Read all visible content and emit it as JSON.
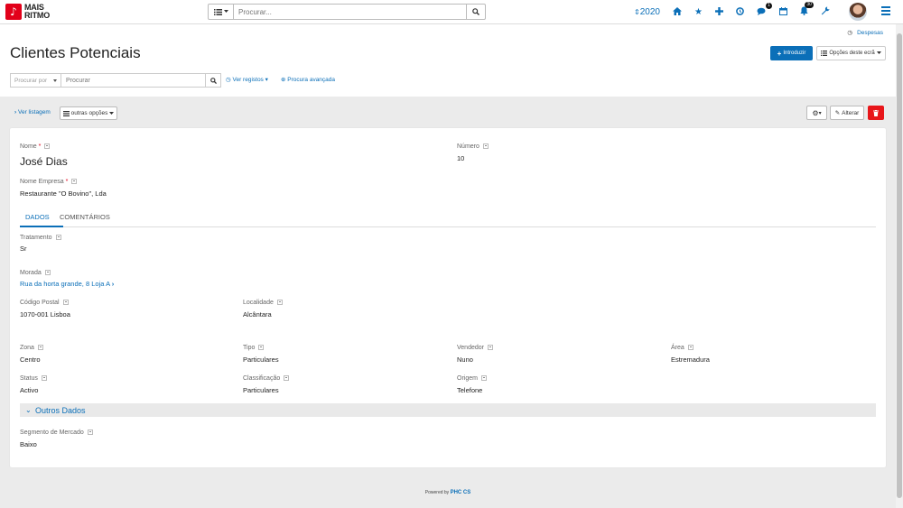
{
  "app": {
    "logo_line1": "MAIS",
    "logo_line2": "RITMO",
    "search_placeholder": "Procurar...",
    "year": "2020",
    "badges": {
      "messages": "1",
      "notifications": "30"
    }
  },
  "header": {
    "despesas": "Despesas",
    "title": "Clientes Potenciais",
    "introduzir": "Introduzir",
    "opcoes": "Opções deste ecrã",
    "search_by": "Procurar por",
    "search_placeholder": "Procurar",
    "ver_registos": "Ver registos",
    "procura_avancada": "Procura avançada"
  },
  "toolbar": {
    "ver_listagem": "Ver listagem",
    "outras_opcoes": "outras opções",
    "alterar": "Alterar"
  },
  "record": {
    "nome_label": "Nome",
    "nome": "José Dias",
    "numero_label": "Número",
    "numero": "10",
    "empresa_label": "Nome Empresa",
    "empresa": "Restaurante \"O Bovino\", Lda"
  },
  "tabs": [
    "DADOS",
    "COMENTÁRIOS"
  ],
  "fields": {
    "tratamento_label": "Tratamento",
    "tratamento": "Sr",
    "morada_label": "Morada",
    "morada": "Rua da horta grande, 8 Loja A",
    "codigo_postal_label": "Código Postal",
    "codigo_postal": "1070-001 Lisboa",
    "localidade_label": "Localidade",
    "localidade": "Alcântara",
    "zona_label": "Zona",
    "zona": "Centro",
    "tipo_label": "Tipo",
    "tipo": "Particulares",
    "vendedor_label": "Vendedor",
    "vendedor": "Nuno",
    "area_label": "Área",
    "area": "Estremadura",
    "status_label": "Status",
    "status": "Activo",
    "classificacao_label": "Classificação",
    "classificacao": "Particulares",
    "origem_label": "Origem",
    "origem": "Telefone"
  },
  "outros": {
    "section_title": "Outros Dados",
    "segmento_label": "Segmento de Mercado",
    "segmento": "Baixo"
  },
  "footer": {
    "powered_by": "Powered by",
    "brand": "PHC CS"
  },
  "colors": {
    "accent": "#0b6fb8",
    "brand_red": "#e2001a",
    "delete_red": "#e8161a"
  }
}
